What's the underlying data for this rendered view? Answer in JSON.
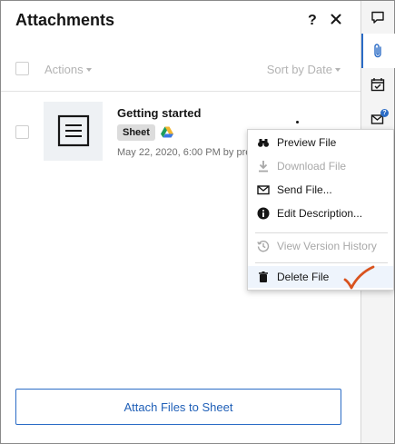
{
  "panel": {
    "title": "Attachments",
    "help_label": "?"
  },
  "toolbar": {
    "actions_label": "Actions",
    "sort_label": "Sort by Date"
  },
  "attachment": {
    "title": "Getting started",
    "badge": "Sheet",
    "meta": "May 22, 2020, 6:00 PM by pre"
  },
  "context_menu": {
    "items": [
      {
        "label": "Preview File",
        "icon": "binoculars-icon",
        "enabled": true
      },
      {
        "label": "Download File",
        "icon": "download-icon",
        "enabled": false
      },
      {
        "label": "Send File...",
        "icon": "envelope-icon",
        "enabled": true
      },
      {
        "label": "Edit Description...",
        "icon": "info-icon",
        "enabled": true
      },
      {
        "label": "View Version History",
        "icon": "history-icon",
        "enabled": false
      },
      {
        "label": "Delete File",
        "icon": "trash-icon",
        "enabled": true
      }
    ]
  },
  "footer": {
    "attach_button_label": "Attach Files to Sheet"
  },
  "rail": {
    "items": [
      {
        "icon": "comments-icon",
        "active": false
      },
      {
        "icon": "paperclip-icon",
        "active": true
      },
      {
        "icon": "calendar-check-icon",
        "active": false
      },
      {
        "icon": "mail-notification-icon",
        "active": false
      }
    ]
  },
  "colors": {
    "accent": "#2b6cc6",
    "annotation": "#d9531e"
  }
}
